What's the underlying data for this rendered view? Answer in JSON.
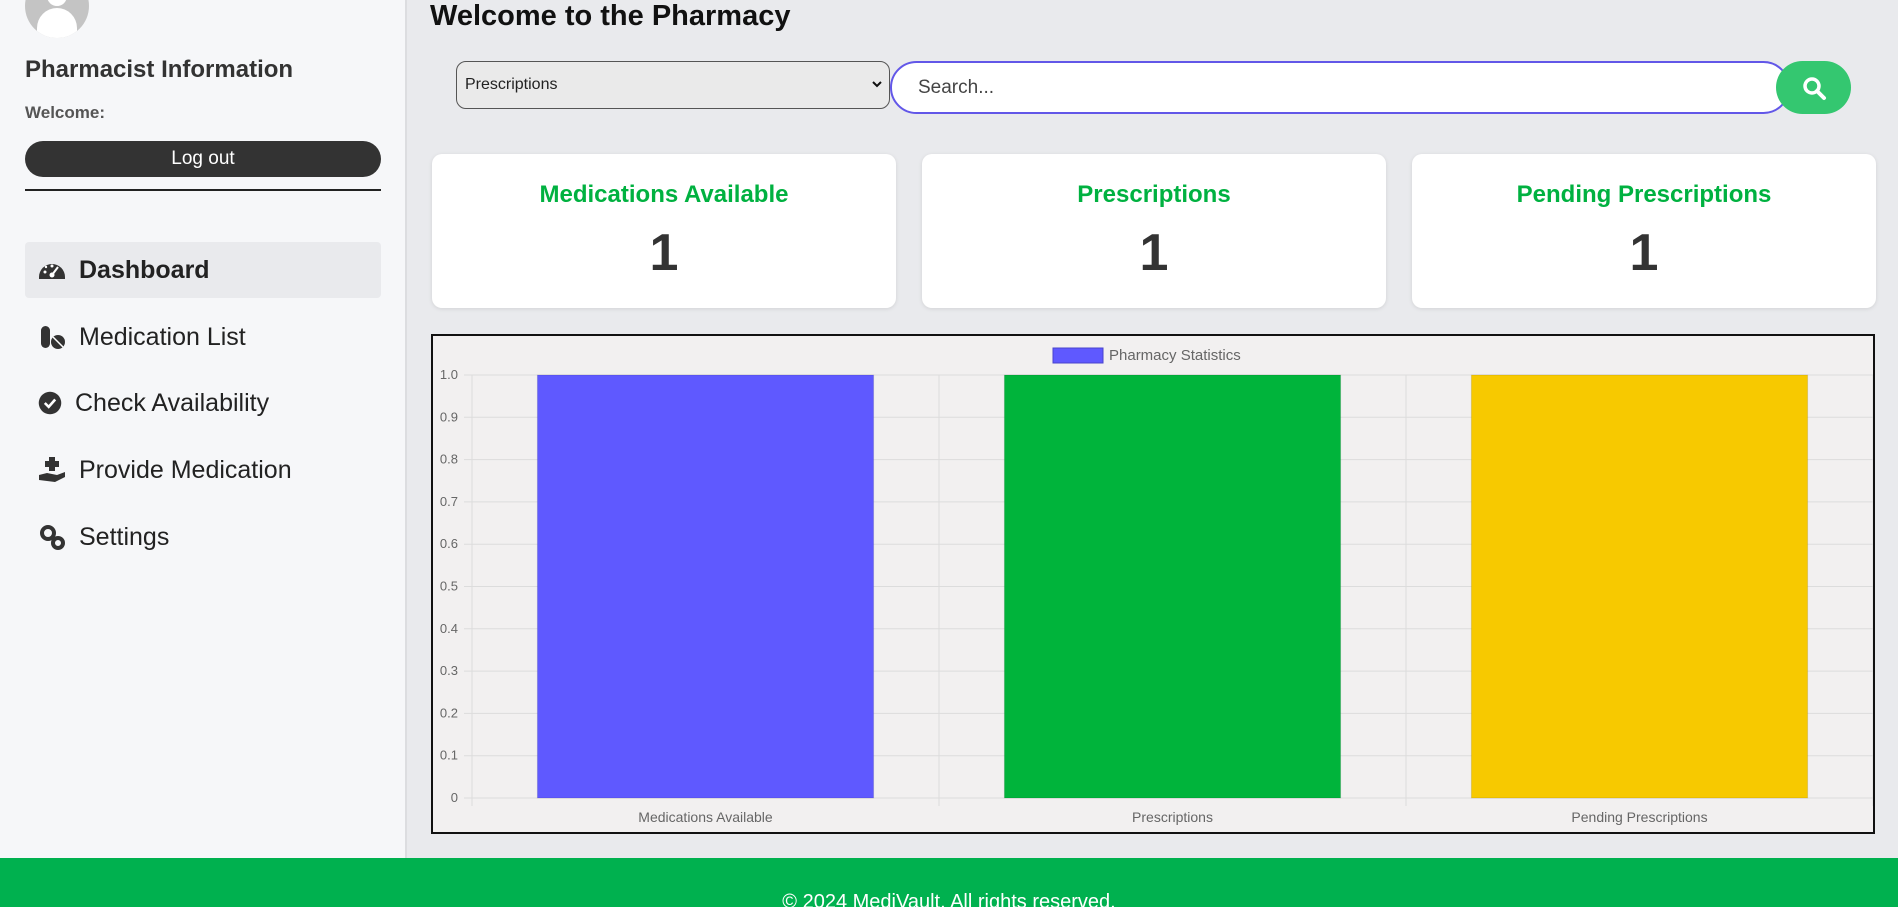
{
  "sidebar": {
    "info_title": "Pharmacist Information",
    "welcome": "Welcome:",
    "logout_label": "Log out",
    "items": [
      {
        "label": "Dashboard",
        "icon": "gauge-icon"
      },
      {
        "label": "Medication List",
        "icon": "pills-icon"
      },
      {
        "label": "Check Availability",
        "icon": "check-circle-icon"
      },
      {
        "label": "Provide Medication",
        "icon": "hand-holding-medical-icon"
      },
      {
        "label": "Settings",
        "icon": "gears-icon"
      }
    ]
  },
  "main": {
    "title": "Welcome to the Pharmacy",
    "select_value": "Prescriptions",
    "search_placeholder": "Search..."
  },
  "cards": [
    {
      "title": "Medications Available",
      "value": "1"
    },
    {
      "title": "Prescriptions",
      "value": "1"
    },
    {
      "title": "Pending Prescriptions",
      "value": "1"
    }
  ],
  "chart_data": {
    "type": "bar",
    "legend": "Pharmacy Statistics",
    "categories": [
      "Medications Available",
      "Prescriptions",
      "Pending Prescriptions"
    ],
    "values": [
      1,
      1,
      1
    ],
    "colors": [
      "#5f59ff",
      "#00b43b",
      "#f7c900"
    ],
    "ylim": [
      0,
      1.0
    ],
    "yticks": [
      "0",
      "0.1",
      "0.2",
      "0.3",
      "0.4",
      "0.5",
      "0.6",
      "0.7",
      "0.8",
      "0.9",
      "1.0"
    ],
    "grid": true,
    "legend_position": "top"
  },
  "footer": {
    "text": "© 2024 MediVault. All rights reserved."
  },
  "colors": {
    "accent_green": "#00b140",
    "footer_green": "#00b14f",
    "search_border": "#6257e8"
  }
}
